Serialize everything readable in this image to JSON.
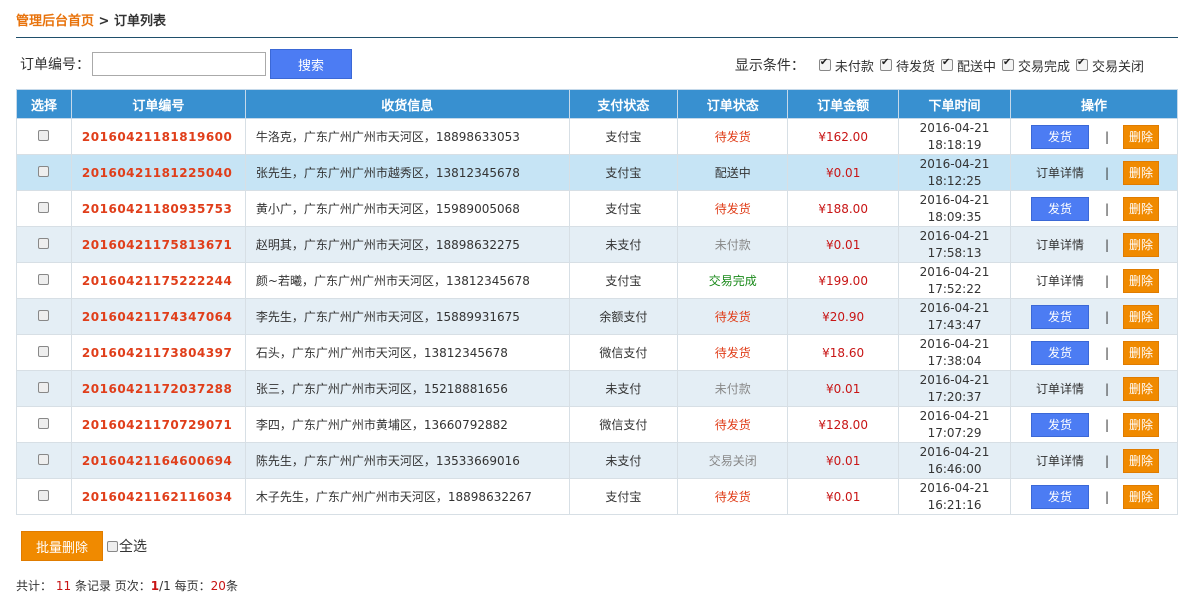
{
  "breadcrumb": {
    "home": "管理后台首页",
    "separator": " > ",
    "current": "订单列表"
  },
  "search": {
    "label": "订单编号：",
    "value": "",
    "placeholder": "",
    "button": "搜索"
  },
  "filters": {
    "title": "显示条件：",
    "options": [
      {
        "label": "未付款",
        "checked": true
      },
      {
        "label": "待发货",
        "checked": true
      },
      {
        "label": "配送中",
        "checked": true
      },
      {
        "label": "交易完成",
        "checked": true
      },
      {
        "label": "交易关闭",
        "checked": true
      }
    ]
  },
  "table": {
    "headers": [
      "选择",
      "订单编号",
      "收货信息",
      "支付状态",
      "订单状态",
      "订单金额",
      "下单时间",
      "操作"
    ],
    "rows": [
      {
        "order_no": "20160421181819600",
        "address": "牛洛克，广东广州广州市天河区，18898633053",
        "payment": "支付宝",
        "status": "待发货",
        "status_type": "red",
        "amount": "¥162.00",
        "date": "2016-04-21",
        "time": "18:18:19",
        "action": "发货",
        "highlight": false
      },
      {
        "order_no": "20160421181225040",
        "address": "张先生，广东广州广州市越秀区，13812345678",
        "payment": "支付宝",
        "status": "配送中",
        "status_type": "blue",
        "amount": "¥0.01",
        "date": "2016-04-21",
        "time": "18:12:25",
        "action": "订单详情",
        "highlight": true
      },
      {
        "order_no": "20160421180935753",
        "address": "黄小广，广东广州广州市天河区，15989005068",
        "payment": "支付宝",
        "status": "待发货",
        "status_type": "red",
        "amount": "¥188.00",
        "date": "2016-04-21",
        "time": "18:09:35",
        "action": "发货",
        "highlight": false
      },
      {
        "order_no": "20160421175813671",
        "address": "赵明其，广东广州广州市天河区，18898632275",
        "payment": "未支付",
        "status": "未付款",
        "status_type": "grey",
        "amount": "¥0.01",
        "date": "2016-04-21",
        "time": "17:58:13",
        "action": "订单详情",
        "highlight": false
      },
      {
        "order_no": "20160421175222244",
        "address": "颜~若曦，广东广州广州市天河区，13812345678",
        "payment": "支付宝",
        "status": "交易完成",
        "status_type": "green",
        "amount": "¥199.00",
        "date": "2016-04-21",
        "time": "17:52:22",
        "action": "订单详情",
        "highlight": false
      },
      {
        "order_no": "20160421174347064",
        "address": "李先生，广东广州广州市天河区，15889931675",
        "payment": "余额支付",
        "status": "待发货",
        "status_type": "red",
        "amount": "¥20.90",
        "date": "2016-04-21",
        "time": "17:43:47",
        "action": "发货",
        "highlight": false
      },
      {
        "order_no": "20160421173804397",
        "address": "石头，广东广州广州市天河区，13812345678",
        "payment": "微信支付",
        "status": "待发货",
        "status_type": "red",
        "amount": "¥18.60",
        "date": "2016-04-21",
        "time": "17:38:04",
        "action": "发货",
        "highlight": false
      },
      {
        "order_no": "20160421172037288",
        "address": "张三，广东广州广州市天河区，15218881656",
        "payment": "未支付",
        "status": "未付款",
        "status_type": "grey",
        "amount": "¥0.01",
        "date": "2016-04-21",
        "time": "17:20:37",
        "action": "订单详情",
        "highlight": false
      },
      {
        "order_no": "20160421170729071",
        "address": "李四，广东广州广州市黄埔区，13660792882",
        "payment": "微信支付",
        "status": "待发货",
        "status_type": "red",
        "amount": "¥128.00",
        "date": "2016-04-21",
        "time": "17:07:29",
        "action": "发货",
        "highlight": false
      },
      {
        "order_no": "20160421164600694",
        "address": "陈先生，广东广州广州市天河区，13533669016",
        "payment": "未支付",
        "status": "交易关闭",
        "status_type": "grey",
        "amount": "¥0.01",
        "date": "2016-04-21",
        "time": "16:46:00",
        "action": "订单详情",
        "highlight": false
      },
      {
        "order_no": "20160421162116034",
        "address": "木子先生，广东广州广州市天河区，18898632267",
        "payment": "支付宝",
        "status": "待发货",
        "status_type": "red",
        "amount": "¥0.01",
        "date": "2016-04-21",
        "time": "16:21:16",
        "action": "发货",
        "highlight": false
      }
    ],
    "separator": "|",
    "delete_label": "删除"
  },
  "batch": {
    "delete_button": "批量删除",
    "select_all": "全选"
  },
  "pager": {
    "total_label": "共计：",
    "total": "11",
    "records_label": "条记录 页次：",
    "current_page": "1",
    "total_pages": "/1",
    "per_page_label": " 每页：",
    "per_page": "20",
    "per_page_unit": "条"
  }
}
